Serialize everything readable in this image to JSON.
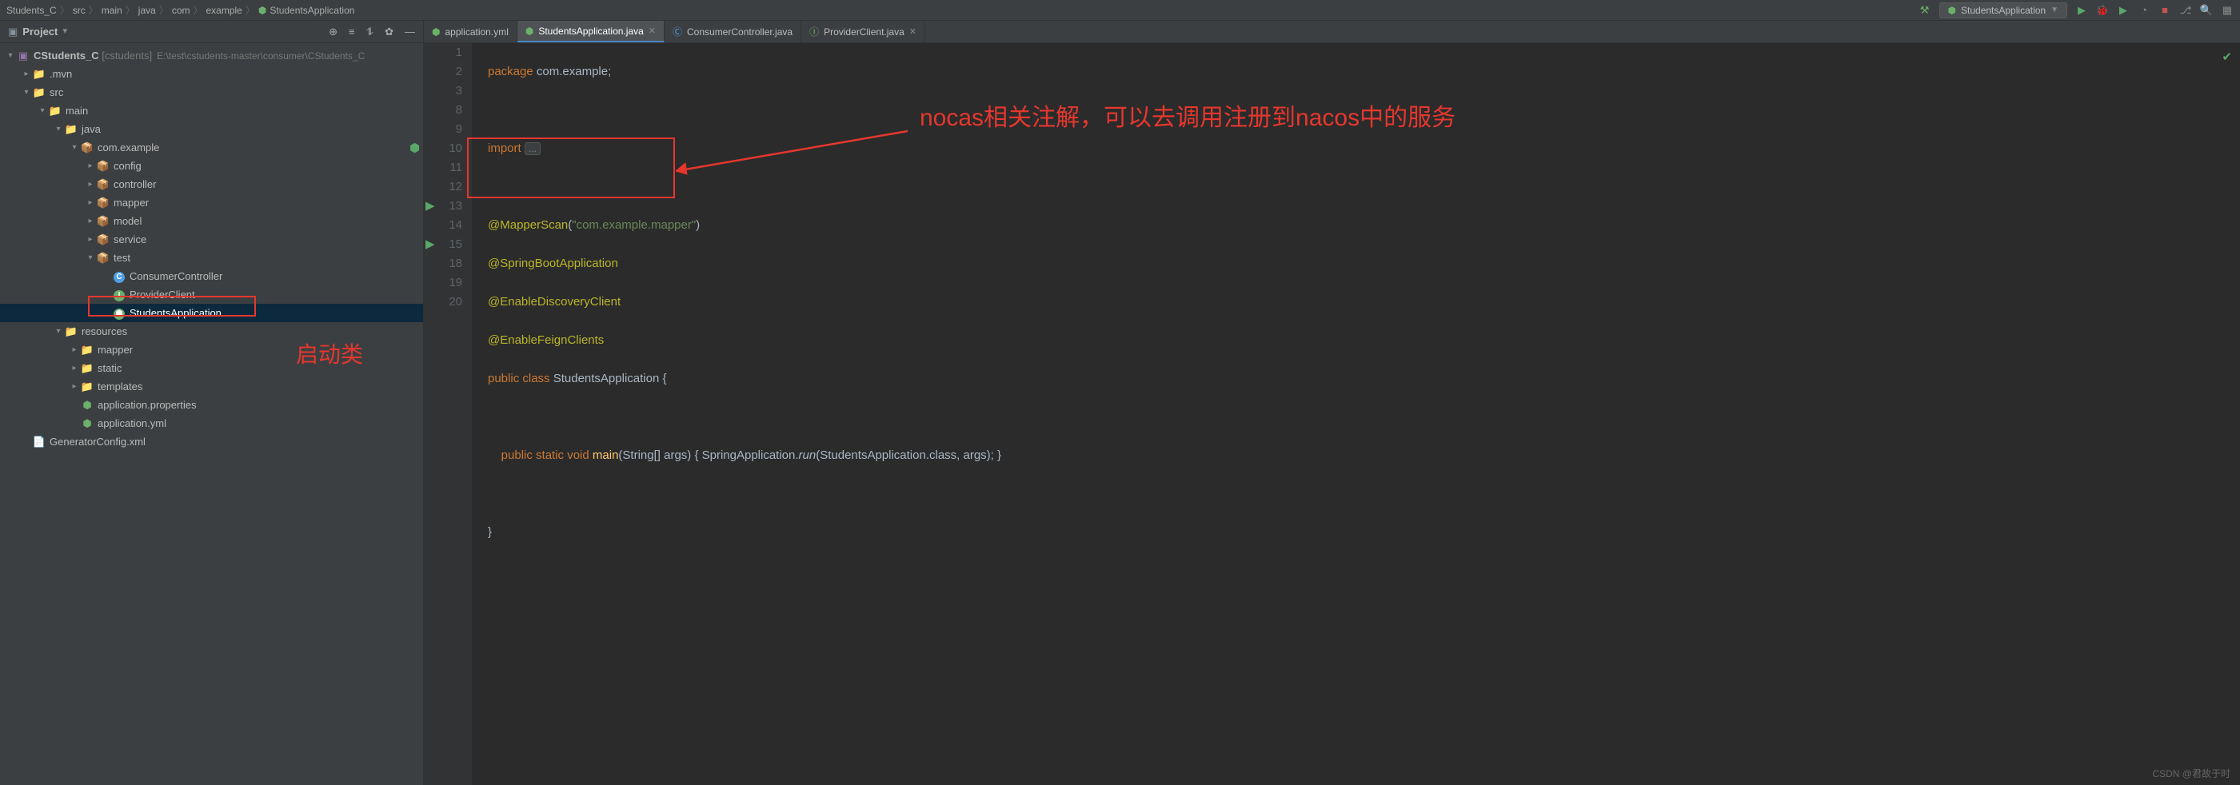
{
  "breadcrumb": [
    "Students_C",
    "src",
    "main",
    "java",
    "com",
    "example",
    "StudentsApplication"
  ],
  "runConfig": {
    "name": "StudentsApplication"
  },
  "projectPanel": {
    "title": "Project",
    "root": {
      "name": "CStudents_C",
      "tag": "[cstudents]",
      "path": "E:\\test\\cstudents-master\\consumer\\CStudents_C"
    },
    "nodes": {
      "mvn": ".mvn",
      "src": "src",
      "main": "main",
      "java": "java",
      "pkg": "com.example",
      "config": "config",
      "controller": "controller",
      "mapper": "mapper",
      "model": "model",
      "service": "service",
      "test": "test",
      "consumerController": "ConsumerController",
      "providerClient": "ProviderClient",
      "studentsApplication": "StudentsApplication",
      "resources": "resources",
      "mapper2": "mapper",
      "static": "static",
      "templates": "templates",
      "appProps": "application.properties",
      "appYml": "application.yml",
      "genCfg": "GeneratorConfig.xml"
    }
  },
  "tabs": [
    {
      "label": "application.yml",
      "active": false
    },
    {
      "label": "StudentsApplication.java",
      "active": true
    },
    {
      "label": "ConsumerController.java",
      "active": false
    },
    {
      "label": "ProviderClient.java",
      "active": false
    }
  ],
  "code": {
    "lineNumbers": [
      "1",
      "2",
      "3",
      "8",
      "9",
      "10",
      "11",
      "12",
      "13",
      "14",
      "15",
      "18",
      "19",
      "20"
    ],
    "package": "package",
    "pkgName": "com.example",
    "import": "import",
    "mapperScan": "@MapperScan",
    "mapperScanArg": "\"com.example.mapper\"",
    "springBoot": "@SpringBootApplication",
    "enableDiscovery": "@EnableDiscoveryClient",
    "enableFeign": "@EnableFeignClients",
    "publicClass": "public class",
    "className": "StudentsApplication",
    "publicStaticVoid": "public static void",
    "main": "main",
    "args": "(String[] args)",
    "body": "{ SpringApplication.",
    "run": "run",
    "bodyEnd": "(StudentsApplication.class, args); }"
  },
  "annotations": {
    "startClass": "启动类",
    "nacosNote": "nocas相关注解，可以去调用注册到nacos中的服务"
  },
  "watermark": "CSDN @君故于时"
}
